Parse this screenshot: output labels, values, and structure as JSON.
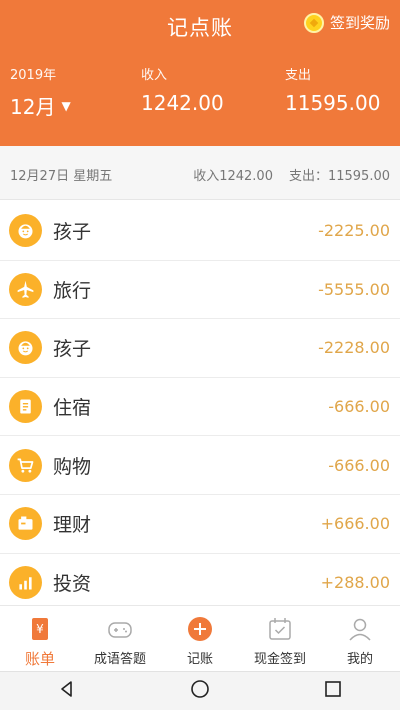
{
  "header": {
    "title": "记点账",
    "reward_label": "签到奖励",
    "year": "2019年",
    "month": "12月",
    "income_label": "收入",
    "income_value": "1242.00",
    "expense_label": "支出",
    "expense_value": "11595.00"
  },
  "summary": {
    "date": "12月27日 星期五",
    "income": "收入1242.00",
    "expense": "支出：11595.00"
  },
  "records": [
    {
      "category": "孩子",
      "amount": "-2225.00",
      "icon": "child-icon"
    },
    {
      "category": "旅行",
      "amount": "-5555.00",
      "icon": "airplane-icon"
    },
    {
      "category": "孩子",
      "amount": "-2228.00",
      "icon": "child-icon"
    },
    {
      "category": "住宿",
      "amount": "-666.00",
      "icon": "lodging-icon"
    },
    {
      "category": "购物",
      "amount": "-666.00",
      "icon": "shopping-cart-icon"
    },
    {
      "category": "理财",
      "amount": "+666.00",
      "icon": "finance-icon"
    },
    {
      "category": "投资",
      "amount": "+288.00",
      "icon": "investment-chart-icon"
    }
  ],
  "tabs": [
    {
      "label": "账单",
      "icon": "ledger-icon",
      "active": true
    },
    {
      "label": "成语答题",
      "icon": "gamepad-icon",
      "active": false
    },
    {
      "label": "记账",
      "icon": "add-circle-icon",
      "active": false
    },
    {
      "label": "现金签到",
      "icon": "calendar-check-icon",
      "active": false
    },
    {
      "label": "我的",
      "icon": "user-icon",
      "active": false
    }
  ],
  "colors": {
    "accent": "#f0793a",
    "icon_bg": "#fbb12a",
    "amount": "#e0a64a"
  }
}
